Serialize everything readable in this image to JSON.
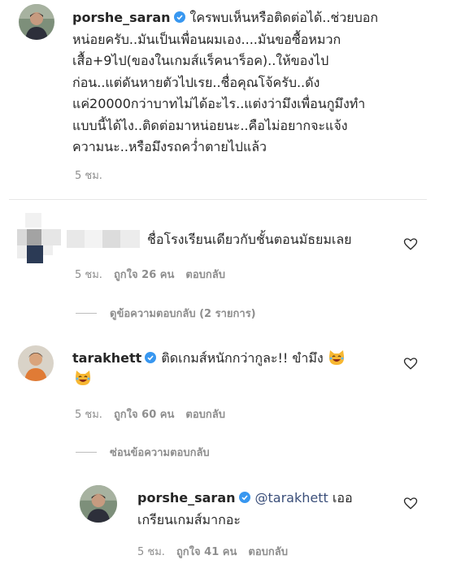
{
  "comments": [
    {
      "username": "porshe_saran",
      "verified": true,
      "text_lines": [
        "ใครพบเห็นหรือติดต่อได้..ช่วยบอก",
        "หน่อยครับ..มันเป็นเพื่อนผมเอง....มันขอซื้อหมวก",
        "เสื้อ+9ไป(ของในเกมส์แร็คนาร็อค)..ให้ของไป",
        "ก่อน..แต่ดันหายตัวไปเรย..ชื่อคุณโจ้ครับ..ดัง",
        "แค่20000กว่าบาทไม่ได้อะไร..แต่งว่ามึงเพื่อนกูมึงทำ",
        "แบบนี้ได้ไง..ติดต่อมาหน่อยนะ..คือไม่อยากจะแจ้ง",
        "ความนะ..หรือมึงรถคว่ำตายไปแล้ว"
      ],
      "time": "5 ชม."
    },
    {
      "username_blurred": true,
      "text": "ชื่อโรงเรียนเดียวกับชั้นตอนมัธยมเลย",
      "time": "5 ชม.",
      "likes": "ถูกใจ 26 คน",
      "reply": "ตอบกลับ",
      "view_replies": "ดูข้อความตอบกลับ (2 รายการ)"
    },
    {
      "username": "tarakhett",
      "verified": true,
      "text": "ติดเกมส์หนักกว่ากูละ!! ขำมึง",
      "time": "5 ชม.",
      "likes": "ถูกใจ 60 คน",
      "reply": "ตอบกลับ",
      "hide_replies": "ซ่อนข้อความตอบกลับ"
    },
    {
      "username": "porshe_saran",
      "verified": true,
      "mention": "@tarakhett",
      "text_line1": "เออ",
      "text_line2": "เกรียนเกมส์มากอะ",
      "time": "5 ชม.",
      "likes": "ถูกใจ 41 คน",
      "reply": "ตอบกลับ"
    }
  ],
  "colors": {
    "verified_blue": "#3897f0",
    "meta_gray": "#8e8e8e",
    "text": "#262626"
  },
  "icons": {
    "like": "heart-outline-icon",
    "verified": "verified-badge-icon",
    "emoji": "laughing-cat-emoji"
  }
}
